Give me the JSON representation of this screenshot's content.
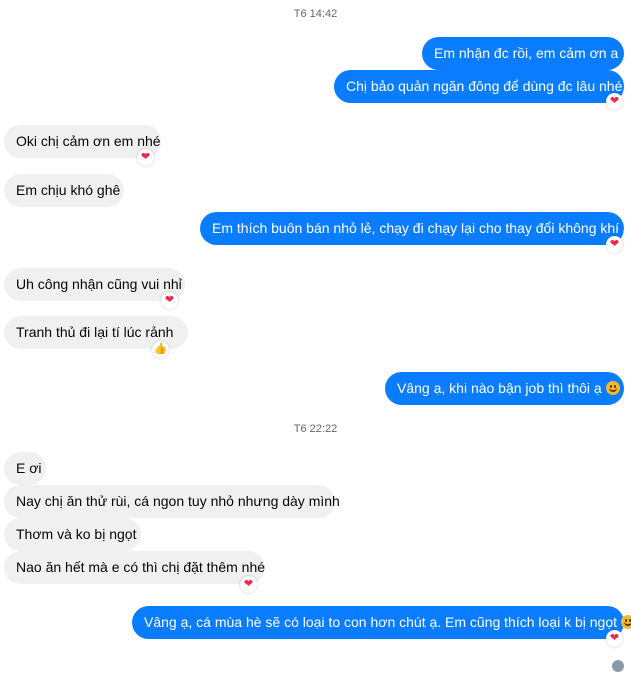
{
  "timestamps": [
    "T6 14:42",
    "T6 22:22"
  ],
  "messages": [
    {
      "text": "Em nhận đc rồi,  em cảm ơn a"
    },
    {
      "text": "Chị bảo quản ngăn đông để dùng đc lâu nhé",
      "reaction": "heart"
    },
    {
      "text": "Oki chị cảm ơn em nhé",
      "reaction": "heart"
    },
    {
      "text": "Em chịu khó ghê"
    },
    {
      "text": "Em thích buôn bán nhỏ lẻ, chạy đi chạy lại cho thay đổi không khí ạ",
      "reaction": "heart"
    },
    {
      "text": "Uh công nhận cũng vui nhỉ",
      "reaction": "heart"
    },
    {
      "text": "Tranh thủ đi lại tí lúc rảnh",
      "reaction": "thumbs-up"
    },
    {
      "text": "Vâng ạ, khi nào bận job thì thôi ạ",
      "emoji": "smile"
    },
    {
      "text": "E ơi"
    },
    {
      "text": "Nay chị ăn thử rùi, cá ngon tuy nhỏ nhưng dày mình"
    },
    {
      "text": "Thơm và ko bị ngọt"
    },
    {
      "text": "Nao ăn hết mà e có thì chị đặt thêm nhé",
      "reaction": "heart"
    },
    {
      "text": "Vâng ạ, cá mùa hè sẽ có loại to con hơn chút ạ. Em cũng thích loại k bị ngọt",
      "emoji": "smile",
      "reaction": "heart"
    }
  ],
  "icons": {
    "heart": "❤",
    "thumb": "👍"
  }
}
